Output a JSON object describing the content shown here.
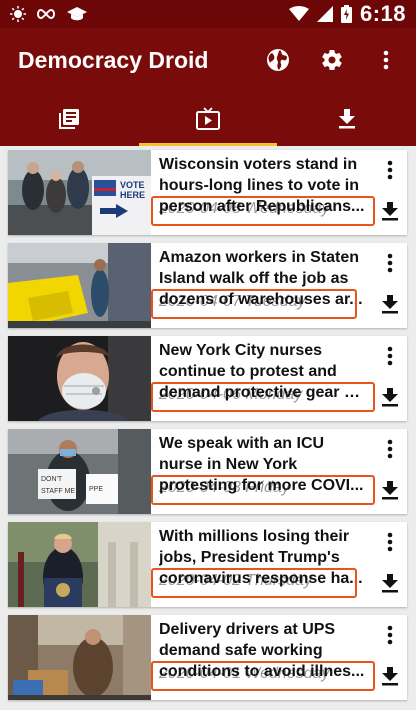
{
  "status_bar": {
    "time": "6:18",
    "icons": [
      "brightness-icon",
      "infinity-icon",
      "graduation-cap-icon",
      "wifi-icon",
      "signal-icon",
      "battery-icon"
    ]
  },
  "app_bar": {
    "title": "Democracy Droid",
    "actions": [
      "globe-icon",
      "settings-icon",
      "more-vert-icon"
    ]
  },
  "tabs": [
    {
      "icon": "articles-icon",
      "active": false
    },
    {
      "icon": "tv-icon",
      "active": true
    },
    {
      "icon": "download-icon",
      "active": false
    }
  ],
  "colors": {
    "primary": "#7a0b0b",
    "primary_dark": "#6d0707",
    "accent": "#f2c230",
    "highlight": "#e8541c"
  },
  "articles": [
    {
      "title_l1": "Wisconsin voters stand in",
      "title_l2": "hours-long lines to vote in",
      "title_l3": "person after Republicans...",
      "date": "2020-04-08 Wednesday"
    },
    {
      "title_l1": "Amazon workers in Staten",
      "title_l2": "Island walk off the job as",
      "title_l3": "dozens of warehouses ar...",
      "date": "2020-04-07 Tuesday"
    },
    {
      "title_l1": "New York City nurses",
      "title_l2": "continue to protest and",
      "title_l3": "demand protective gear a...",
      "date": "2020-04-06 Monday"
    },
    {
      "title_l1": "We speak with an ICU",
      "title_l2": "nurse in New York",
      "title_l3": "protesting for more COVI...",
      "date": "2020-04-03 Friday"
    },
    {
      "title_l1": "With millions losing their",
      "title_l2": "jobs, President Trump's",
      "title_l3": "coronavirus response ha...",
      "date": "2020-04-02 Thursday"
    },
    {
      "title_l1": "Delivery drivers at UPS",
      "title_l2": "demand safe working",
      "title_l3": "conditions to avoid illnes...",
      "date": "2020-04-01 Wednesday"
    }
  ]
}
